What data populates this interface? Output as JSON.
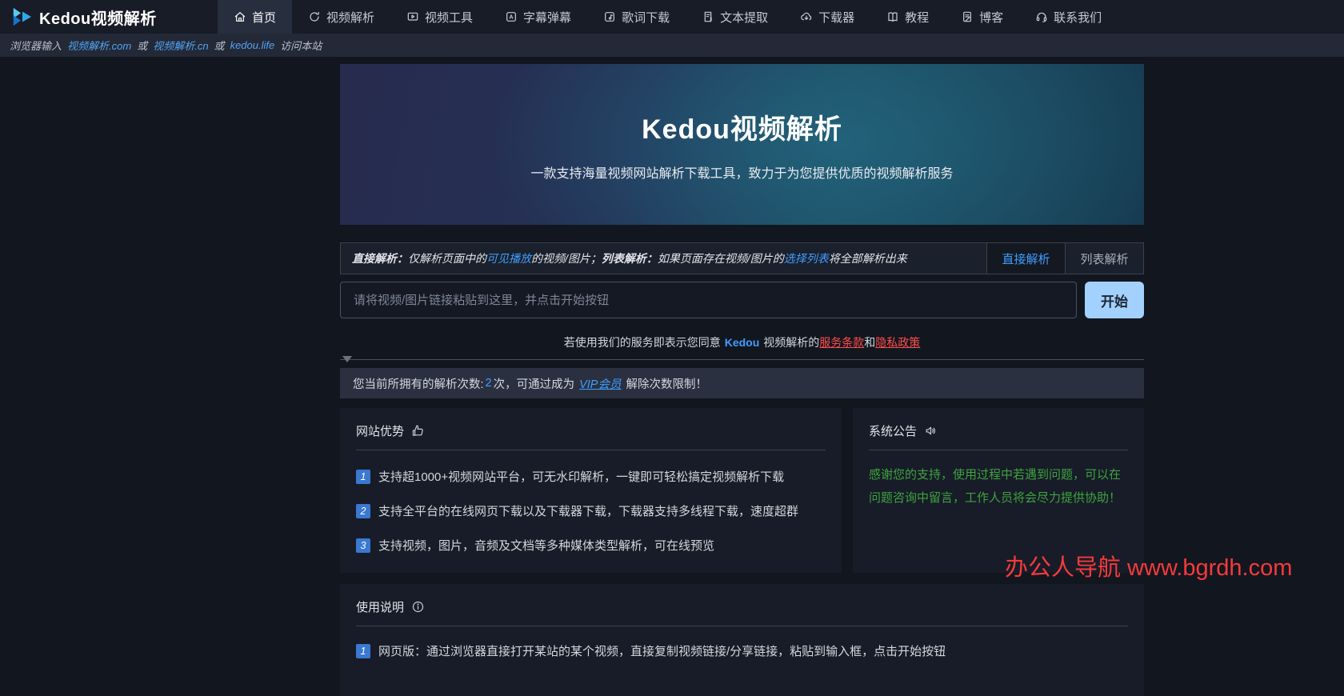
{
  "brand": {
    "name": "Kedou视频解析"
  },
  "navbar": {
    "items": [
      {
        "label": "首页",
        "icon": "home-icon",
        "active": true
      },
      {
        "label": "视频解析",
        "icon": "video-parse-icon",
        "active": false
      },
      {
        "label": "视频工具",
        "icon": "video-tools-icon",
        "active": false
      },
      {
        "label": "字幕弹幕",
        "icon": "subtitle-danmaku-icon",
        "active": false
      },
      {
        "label": "歌词下载",
        "icon": "lyrics-download-icon",
        "active": false
      },
      {
        "label": "文本提取",
        "icon": "text-extract-icon",
        "active": false
      },
      {
        "label": "下载器",
        "icon": "downloader-icon",
        "active": false
      },
      {
        "label": "教程",
        "icon": "tutorial-icon",
        "active": false
      },
      {
        "label": "博客",
        "icon": "blog-icon",
        "active": false
      },
      {
        "label": "联系我们",
        "icon": "contact-icon",
        "active": false
      }
    ]
  },
  "address_bar": {
    "prefix": "浏览器输入",
    "link1": "视频解析.com",
    "or1": "或",
    "link2": "视频解析.cn",
    "or2": "或",
    "link3": "kedou.life",
    "suffix": "访问本站"
  },
  "hero": {
    "title": "Kedou视频解析",
    "subtitle": "一款支持海量视频网站解析下载工具，致力于为您提供优质的视频解析服务"
  },
  "parse": {
    "desc": {
      "b1": "直接解析：",
      "t1": "仅解析页面中的",
      "link1": "可见播放",
      "t2": "的视频/图片；",
      "b2": "列表解析：",
      "t3": "如果页面存在视频/图片的",
      "link2": "选择列表",
      "t4": "将全部解析出来"
    },
    "tabs": {
      "direct": "直接解析",
      "list": "列表解析"
    },
    "input_placeholder": "请将视频/图片链接粘贴到这里，并点击开始按钮",
    "start_button": "开始",
    "agreement": {
      "t1": "若使用我们的服务即表示您同意",
      "brand": "Kedou",
      "t2": "视频解析的",
      "terms": "服务条款",
      "and": "和",
      "privacy": "隐私政策"
    }
  },
  "notice": {
    "t1": "您当前所拥有的解析次数:",
    "count": "2",
    "t2": "次，可通过成为",
    "vip": "VIP会员",
    "t3": "解除次数限制！"
  },
  "advantages": {
    "title": "网站优势",
    "icon": "thumbs-up-icon",
    "items": [
      {
        "num": "1",
        "text": "支持超1000+视频网站平台，可无水印解析，一键即可轻松搞定视频解析下载"
      },
      {
        "num": "2",
        "text": "支持全平台的在线网页下载以及下载器下载，下载器支持多线程下载，速度超群"
      },
      {
        "num": "3",
        "text": "支持视频，图片，音频及文档等多种媒体类型解析，可在线预览"
      }
    ]
  },
  "announcement": {
    "title": "系统公告",
    "icon": "speaker-icon",
    "text": "感谢您的支持，使用过程中若遇到问题，可以在问题咨询中留言，工作人员将会尽力提供协助！"
  },
  "usage": {
    "title": "使用说明",
    "icon": "info-circle-icon",
    "items": [
      {
        "num": "1",
        "text": "网页版：通过浏览器直接打开某站的某个视频，直接复制视频链接/分享链接，粘贴到输入框，点击开始按钮"
      }
    ]
  },
  "watermark": "办公人导航 www.bgrdh.com",
  "colors": {
    "accent_blue": "#409eff",
    "start_button_blue": "#a3d1fd",
    "link_red": "#ff4d4d",
    "watermark_red": "#f43b3b",
    "announcement_green": "#3fa33f",
    "badge_blue": "#3a78d2",
    "navbar_bg": "#171c27",
    "page_bg": "#12161f"
  }
}
